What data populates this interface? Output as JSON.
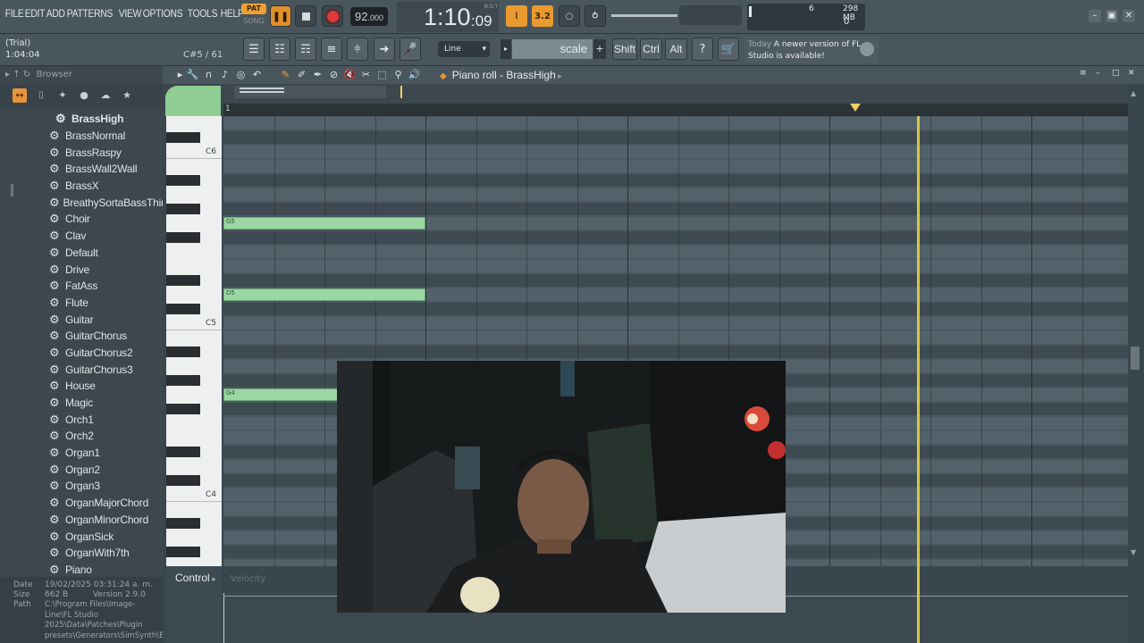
{
  "menu": [
    "FILE",
    "EDIT",
    "ADD",
    "PATTERNS",
    "VIEW",
    "OPTIONS",
    "TOOLS",
    "HELP"
  ],
  "transport": {
    "pat_label": "PAT",
    "song_label": "SONG",
    "pause_label": "❚❚",
    "tempo_int": "92",
    "tempo_dec": ".000",
    "time_main": "1:10",
    "time_sub": ":09",
    "time_unit": "B:S:T",
    "metro_label": "⌇",
    "blend_label": "3.2"
  },
  "cpu": {
    "voices": "6",
    "memory": "298 MB",
    "poly": "0"
  },
  "hint": {
    "line1": "(Trial)",
    "line2": "1:04:04"
  },
  "note_pos": "C#5 / 61",
  "snap": "Line",
  "scale_label": "scale",
  "keys": {
    "shift": "Shift",
    "ctrl": "Ctrl",
    "alt": "Alt"
  },
  "news": {
    "today": "Today",
    "message": "A newer version of FL Studio is available!"
  },
  "browser": {
    "title": "Browser",
    "selected": "BrassHigh",
    "items": [
      "BrassNormal",
      "BrassRaspy",
      "BrassWall2Wall",
      "BrassX",
      "BreathySortaBassThing",
      "Choir",
      "Clav",
      "Default",
      "Drive",
      "FatAss",
      "Flute",
      "Guitar",
      "GuitarChorus",
      "GuitarChorus2",
      "GuitarChorus3",
      "House",
      "Magic",
      "Orch1",
      "Orch2",
      "Organ1",
      "Organ2",
      "Organ3",
      "OrganMajorChord",
      "OrganMinorChord",
      "OrganSick",
      "OrganWith7th",
      "Piano"
    ],
    "info": {
      "date_key": "Date",
      "date": "19/02/2025 03:31:24 a. m.",
      "size_key": "Size",
      "size": "662 B",
      "version": "Version 2.9.0",
      "path_key": "Path",
      "path": "C:\\Program Files\\Image-Line\\FL Studio 2025\\Data\\Patches\\Plugin presets\\Generators\\SimSynth\\BrassHigh.fst"
    }
  },
  "piano_roll": {
    "title": "Piano roll - BrassHigh",
    "bar_number": "1",
    "octave_labels": {
      "c6": "C6",
      "c5": "C5",
      "c4": "C4"
    },
    "notes": [
      {
        "name": "G5",
        "start_beat": 0,
        "length_beats": 4
      },
      {
        "name": "D5",
        "start_beat": 0,
        "length_beats": 4
      },
      {
        "name": "G4",
        "start_beat": 0,
        "length_beats": 4
      }
    ],
    "control_label": "Control",
    "control_param": "Velocity"
  }
}
